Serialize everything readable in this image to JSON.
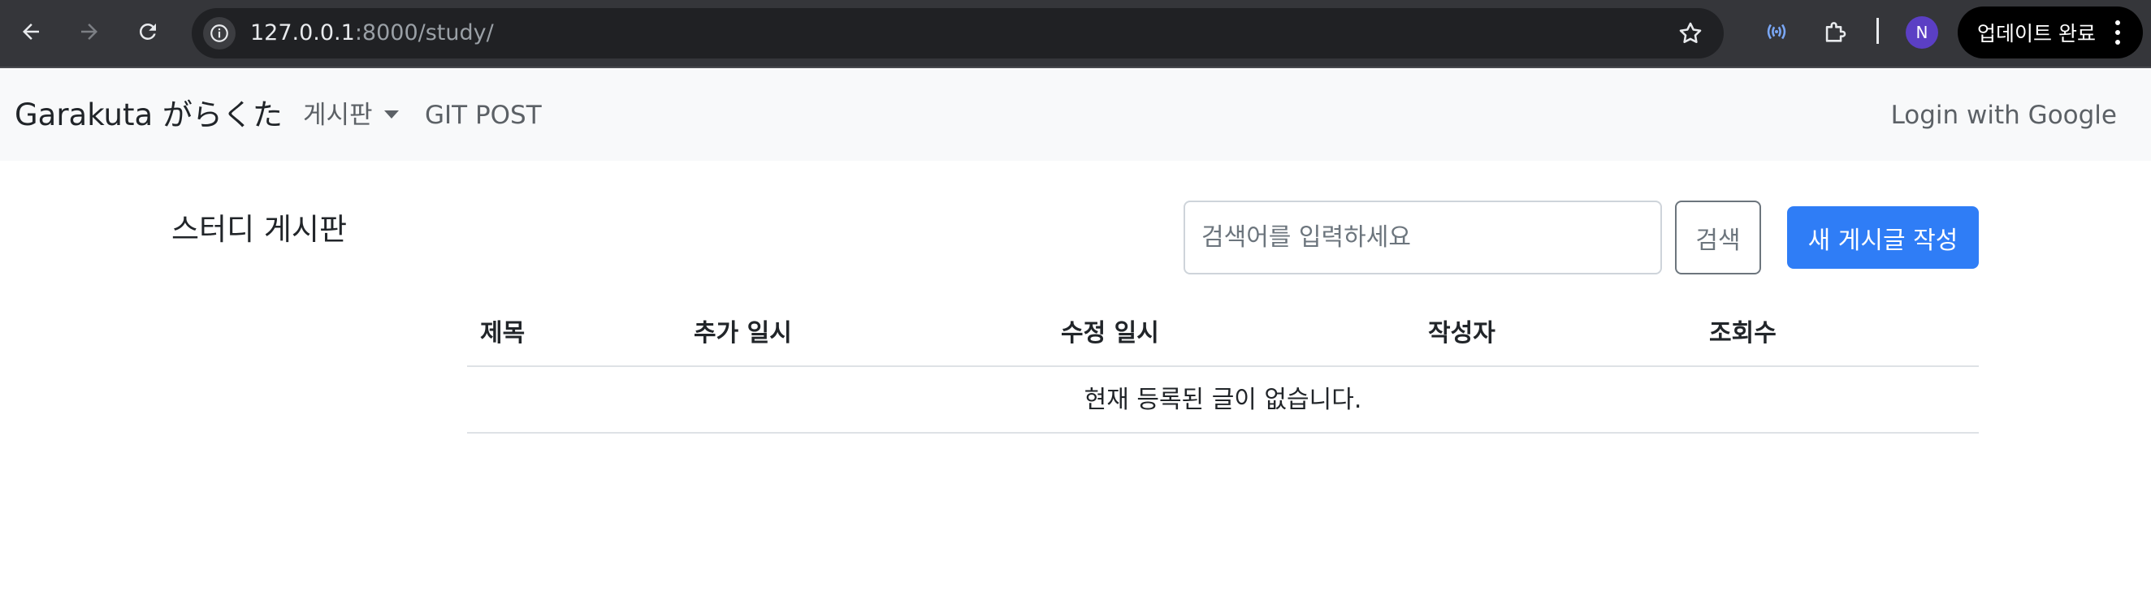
{
  "browser": {
    "url_host": "127.0.0.1",
    "url_rest": ":8000/study/",
    "profile_initial": "N",
    "update_label": "업데이트 완료"
  },
  "navbar": {
    "brand": "Garakuta がらくた",
    "board_menu": "게시판",
    "git_post": "GIT POST",
    "login": "Login with Google"
  },
  "main": {
    "title": "스터디 게시판",
    "search_placeholder": "검색어를 입력하세요",
    "search_value": "",
    "search_button": "검색",
    "new_post_button": "새 게시글 작성"
  },
  "table": {
    "columns": [
      "제목",
      "추가 일시",
      "수정 일시",
      "작성자",
      "조회수"
    ],
    "rows": [],
    "empty_message": "현재 등록된 글이 없습니다."
  },
  "colors": {
    "primary": "#2f7df6",
    "navbar_bg": "#f8f9fa",
    "chrome_bg": "#35363a"
  }
}
